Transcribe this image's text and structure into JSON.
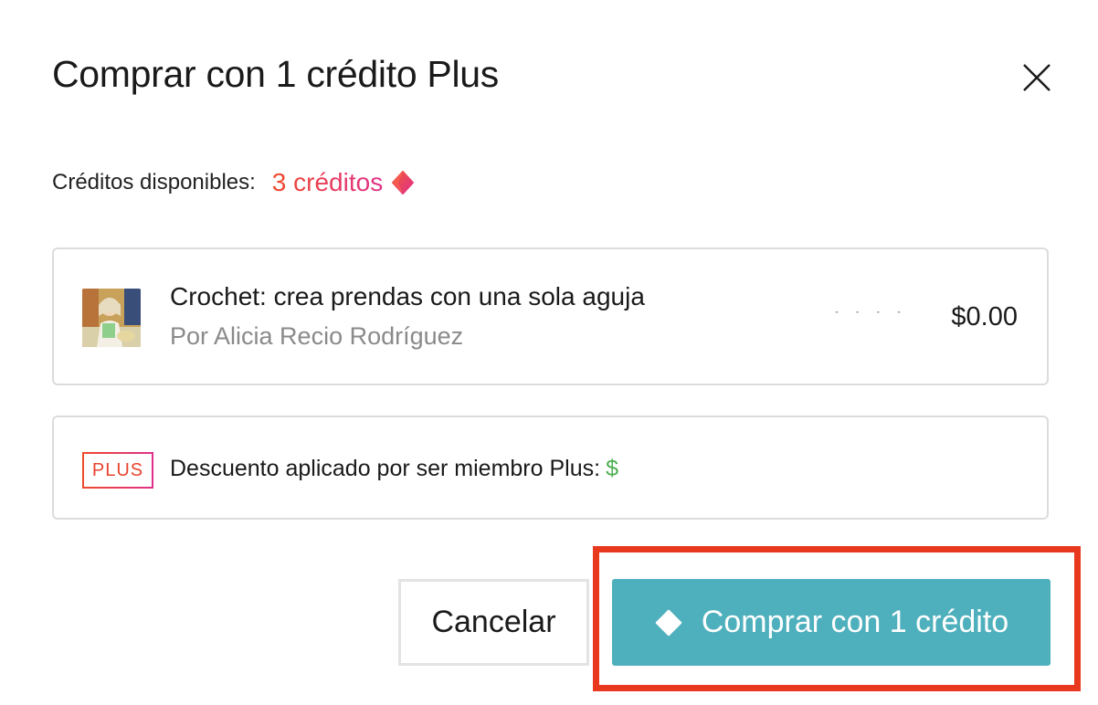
{
  "dialog": {
    "title": "Comprar con 1 crédito Plus",
    "close_icon": "close-icon"
  },
  "credits": {
    "label": "Créditos disponibles:",
    "value": "3 créditos",
    "icon": "credit-gem-icon",
    "gradient_colors": [
      "#ee4a2a",
      "#e0308a"
    ]
  },
  "course": {
    "title": "Crochet: crea prendas con una sola aguja",
    "author": "Por Alicia Recio Rodríguez",
    "original_price": "·  ·   · ·  ·",
    "price": "$0.00",
    "thumbnail": "course-thumbnail"
  },
  "discount": {
    "badge": "PLUS",
    "text": "Descuento aplicado por ser miembro Plus:",
    "amount": "$",
    "amount_color": "#4caf50"
  },
  "actions": {
    "cancel_label": "Cancelar",
    "buy_label": "Comprar con 1 crédito",
    "buy_icon": "diamond-icon",
    "buy_color": "#4fb0bd",
    "highlight_color": "#e8391f"
  }
}
